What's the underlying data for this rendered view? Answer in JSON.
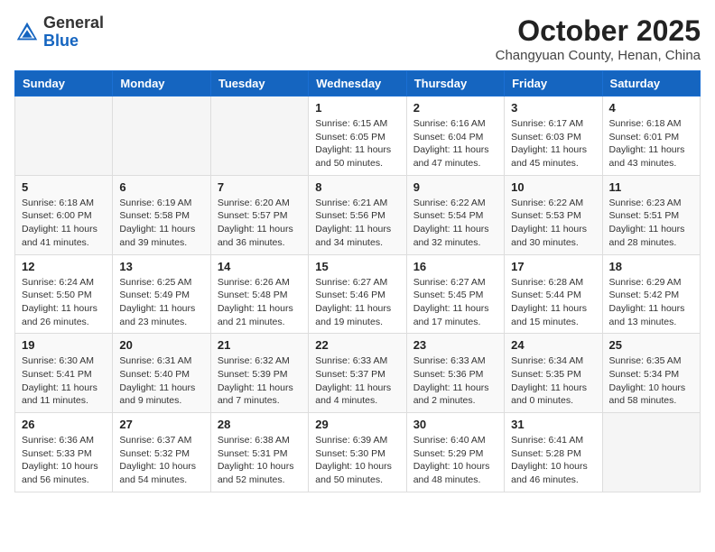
{
  "header": {
    "logo_general": "General",
    "logo_blue": "Blue",
    "month_title": "October 2025",
    "location": "Changyuan County, Henan, China"
  },
  "weekdays": [
    "Sunday",
    "Monday",
    "Tuesday",
    "Wednesday",
    "Thursday",
    "Friday",
    "Saturday"
  ],
  "weeks": [
    [
      {
        "day": "",
        "info": ""
      },
      {
        "day": "",
        "info": ""
      },
      {
        "day": "",
        "info": ""
      },
      {
        "day": "1",
        "info": "Sunrise: 6:15 AM\nSunset: 6:05 PM\nDaylight: 11 hours\nand 50 minutes."
      },
      {
        "day": "2",
        "info": "Sunrise: 6:16 AM\nSunset: 6:04 PM\nDaylight: 11 hours\nand 47 minutes."
      },
      {
        "day": "3",
        "info": "Sunrise: 6:17 AM\nSunset: 6:03 PM\nDaylight: 11 hours\nand 45 minutes."
      },
      {
        "day": "4",
        "info": "Sunrise: 6:18 AM\nSunset: 6:01 PM\nDaylight: 11 hours\nand 43 minutes."
      }
    ],
    [
      {
        "day": "5",
        "info": "Sunrise: 6:18 AM\nSunset: 6:00 PM\nDaylight: 11 hours\nand 41 minutes."
      },
      {
        "day": "6",
        "info": "Sunrise: 6:19 AM\nSunset: 5:58 PM\nDaylight: 11 hours\nand 39 minutes."
      },
      {
        "day": "7",
        "info": "Sunrise: 6:20 AM\nSunset: 5:57 PM\nDaylight: 11 hours\nand 36 minutes."
      },
      {
        "day": "8",
        "info": "Sunrise: 6:21 AM\nSunset: 5:56 PM\nDaylight: 11 hours\nand 34 minutes."
      },
      {
        "day": "9",
        "info": "Sunrise: 6:22 AM\nSunset: 5:54 PM\nDaylight: 11 hours\nand 32 minutes."
      },
      {
        "day": "10",
        "info": "Sunrise: 6:22 AM\nSunset: 5:53 PM\nDaylight: 11 hours\nand 30 minutes."
      },
      {
        "day": "11",
        "info": "Sunrise: 6:23 AM\nSunset: 5:51 PM\nDaylight: 11 hours\nand 28 minutes."
      }
    ],
    [
      {
        "day": "12",
        "info": "Sunrise: 6:24 AM\nSunset: 5:50 PM\nDaylight: 11 hours\nand 26 minutes."
      },
      {
        "day": "13",
        "info": "Sunrise: 6:25 AM\nSunset: 5:49 PM\nDaylight: 11 hours\nand 23 minutes."
      },
      {
        "day": "14",
        "info": "Sunrise: 6:26 AM\nSunset: 5:48 PM\nDaylight: 11 hours\nand 21 minutes."
      },
      {
        "day": "15",
        "info": "Sunrise: 6:27 AM\nSunset: 5:46 PM\nDaylight: 11 hours\nand 19 minutes."
      },
      {
        "day": "16",
        "info": "Sunrise: 6:27 AM\nSunset: 5:45 PM\nDaylight: 11 hours\nand 17 minutes."
      },
      {
        "day": "17",
        "info": "Sunrise: 6:28 AM\nSunset: 5:44 PM\nDaylight: 11 hours\nand 15 minutes."
      },
      {
        "day": "18",
        "info": "Sunrise: 6:29 AM\nSunset: 5:42 PM\nDaylight: 11 hours\nand 13 minutes."
      }
    ],
    [
      {
        "day": "19",
        "info": "Sunrise: 6:30 AM\nSunset: 5:41 PM\nDaylight: 11 hours\nand 11 minutes."
      },
      {
        "day": "20",
        "info": "Sunrise: 6:31 AM\nSunset: 5:40 PM\nDaylight: 11 hours\nand 9 minutes."
      },
      {
        "day": "21",
        "info": "Sunrise: 6:32 AM\nSunset: 5:39 PM\nDaylight: 11 hours\nand 7 minutes."
      },
      {
        "day": "22",
        "info": "Sunrise: 6:33 AM\nSunset: 5:37 PM\nDaylight: 11 hours\nand 4 minutes."
      },
      {
        "day": "23",
        "info": "Sunrise: 6:33 AM\nSunset: 5:36 PM\nDaylight: 11 hours\nand 2 minutes."
      },
      {
        "day": "24",
        "info": "Sunrise: 6:34 AM\nSunset: 5:35 PM\nDaylight: 11 hours\nand 0 minutes."
      },
      {
        "day": "25",
        "info": "Sunrise: 6:35 AM\nSunset: 5:34 PM\nDaylight: 10 hours\nand 58 minutes."
      }
    ],
    [
      {
        "day": "26",
        "info": "Sunrise: 6:36 AM\nSunset: 5:33 PM\nDaylight: 10 hours\nand 56 minutes."
      },
      {
        "day": "27",
        "info": "Sunrise: 6:37 AM\nSunset: 5:32 PM\nDaylight: 10 hours\nand 54 minutes."
      },
      {
        "day": "28",
        "info": "Sunrise: 6:38 AM\nSunset: 5:31 PM\nDaylight: 10 hours\nand 52 minutes."
      },
      {
        "day": "29",
        "info": "Sunrise: 6:39 AM\nSunset: 5:30 PM\nDaylight: 10 hours\nand 50 minutes."
      },
      {
        "day": "30",
        "info": "Sunrise: 6:40 AM\nSunset: 5:29 PM\nDaylight: 10 hours\nand 48 minutes."
      },
      {
        "day": "31",
        "info": "Sunrise: 6:41 AM\nSunset: 5:28 PM\nDaylight: 10 hours\nand 46 minutes."
      },
      {
        "day": "",
        "info": ""
      }
    ]
  ]
}
